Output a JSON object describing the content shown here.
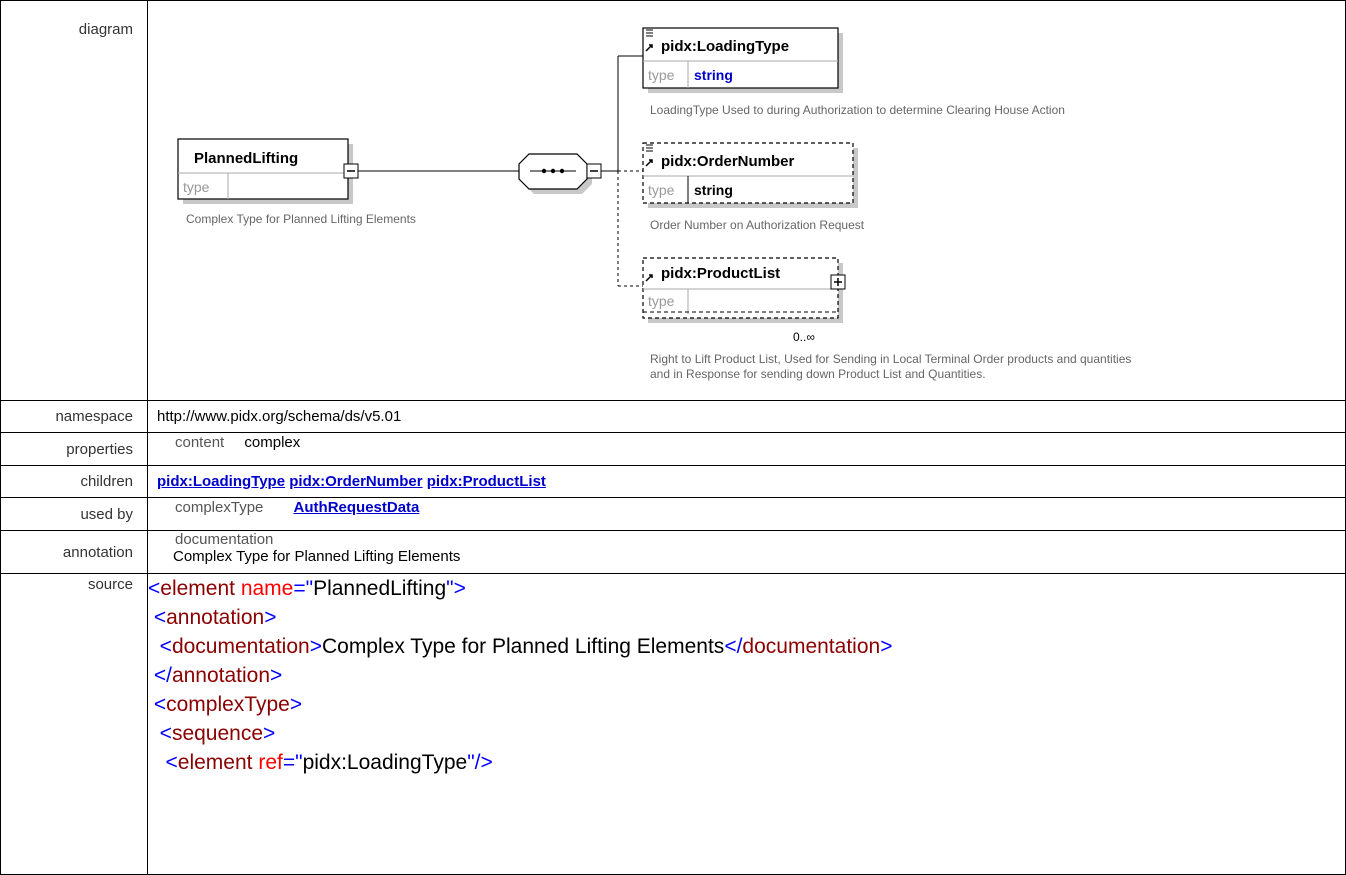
{
  "rows": {
    "diagram_label": "diagram",
    "namespace_label": "namespace",
    "namespace_value": "http://www.pidx.org/schema/ds/v5.01",
    "properties_label": "properties",
    "properties_key": "content",
    "properties_value": "complex",
    "children_label": "children",
    "children": [
      "pidx:LoadingType",
      "pidx:OrderNumber",
      "pidx:ProductList"
    ],
    "usedby_label": "used by",
    "usedby_key": "complexType",
    "usedby_value": "AuthRequestData",
    "annotation_label": "annotation",
    "annotation_key": "documentation",
    "annotation_value": "Complex Type for Planned Lifting Elements",
    "source_label": "source"
  },
  "diagram": {
    "root": {
      "name": "PlannedLifting",
      "type_label": "type",
      "type_value": "",
      "doc": "Complex Type for Planned Lifting Elements"
    },
    "children": [
      {
        "name": "pidx:LoadingType",
        "type_label": "type",
        "type_value": "string",
        "doc": "LoadingType Used to during Authorization to determine Clearing House Action",
        "optional": false
      },
      {
        "name": "pidx:OrderNumber",
        "type_label": "type",
        "type_value": "string",
        "doc": "Order Number on Authorization Request",
        "optional": true
      },
      {
        "name": "pidx:ProductList",
        "type_label": "type",
        "type_value": "",
        "doc_line1": "Right to Lift Product List, Used for Sending in Local Terminal Order products and quantities",
        "doc_line2": "and in Response for sending down Product List and Quantities.",
        "optional": true,
        "cardinality": "0..∞"
      }
    ]
  },
  "source": {
    "lines": [
      [
        [
          "br",
          "<"
        ],
        [
          "tag",
          "element "
        ],
        [
          "attr",
          "name"
        ],
        [
          "br",
          "=\""
        ],
        [
          "val",
          "PlannedLifting"
        ],
        [
          "br",
          "\">"
        ]
      ],
      [
        [
          "txt",
          " "
        ],
        [
          "br",
          "<"
        ],
        [
          "tag",
          "annotation"
        ],
        [
          "br",
          ">"
        ]
      ],
      [
        [
          "txt",
          "  "
        ],
        [
          "br",
          "<"
        ],
        [
          "tag",
          "documentation"
        ],
        [
          "br",
          ">"
        ],
        [
          "txt",
          "Complex Type for Planned Lifting Elements"
        ],
        [
          "br",
          "</"
        ],
        [
          "tag",
          "documentation"
        ],
        [
          "br",
          ">"
        ]
      ],
      [
        [
          "txt",
          " "
        ],
        [
          "br",
          "</"
        ],
        [
          "tag",
          "annotation"
        ],
        [
          "br",
          ">"
        ]
      ],
      [
        [
          "txt",
          " "
        ],
        [
          "br",
          "<"
        ],
        [
          "tag",
          "complexType"
        ],
        [
          "br",
          ">"
        ]
      ],
      [
        [
          "txt",
          "  "
        ],
        [
          "br",
          "<"
        ],
        [
          "tag",
          "sequence"
        ],
        [
          "br",
          ">"
        ]
      ],
      [
        [
          "txt",
          "   "
        ],
        [
          "br",
          "<"
        ],
        [
          "tag",
          "element "
        ],
        [
          "attr",
          "ref"
        ],
        [
          "br",
          "=\""
        ],
        [
          "val",
          "pidx:LoadingType"
        ],
        [
          "br",
          "\"/>"
        ]
      ]
    ]
  }
}
